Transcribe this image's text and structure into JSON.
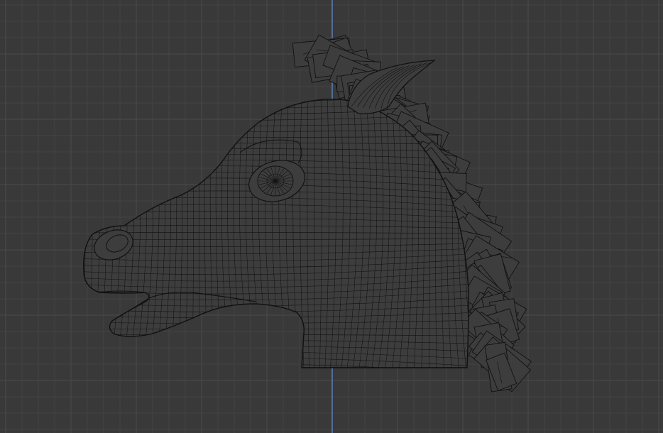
{
  "viewport": {
    "background_color": "#393939",
    "grid_minor_color": "#434343",
    "grid_major_color": "#4b4b4b",
    "axis_color": "#5a7fb5",
    "mesh_fill_color": "#3d3d3d",
    "mesh_wire_color": "#111111"
  },
  "model": {
    "subject": "horse-head-mask",
    "display_mode": "wireframe"
  }
}
